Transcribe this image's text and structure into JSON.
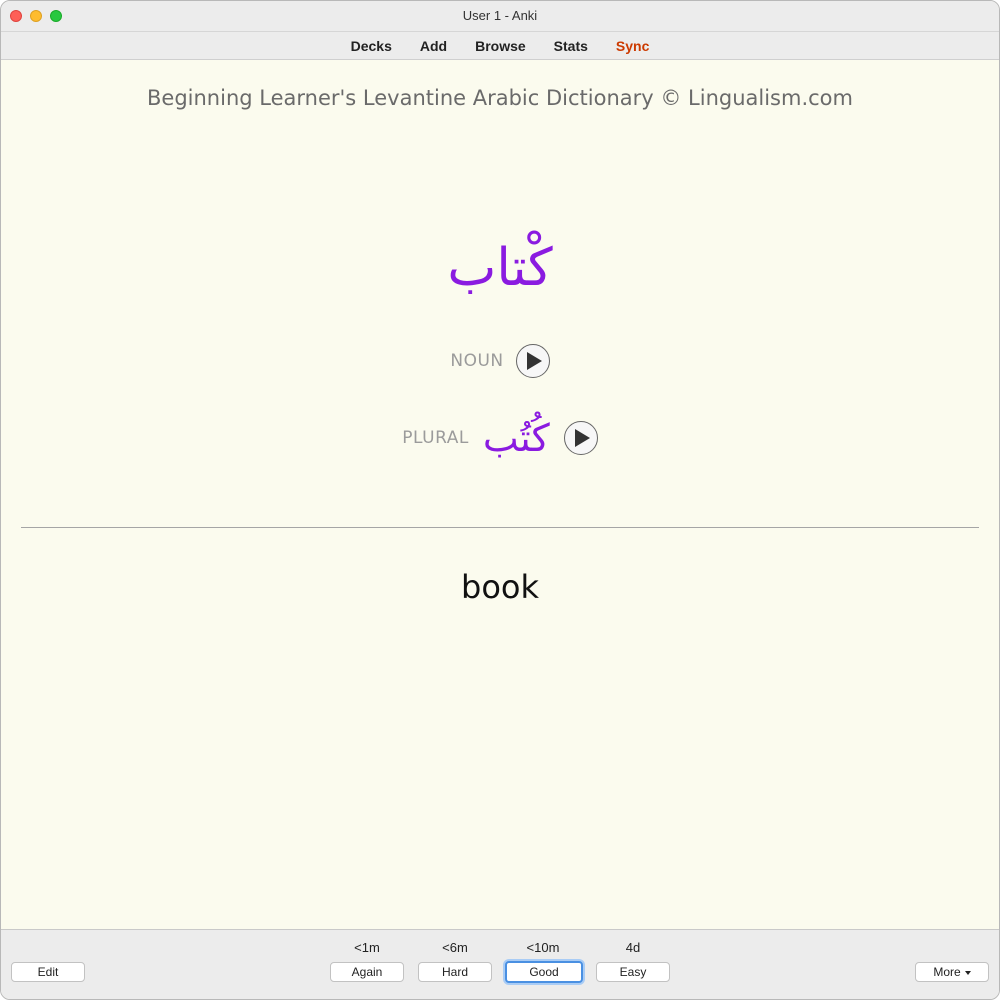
{
  "window": {
    "title": "User 1 - Anki"
  },
  "menu": {
    "decks": "Decks",
    "add": "Add",
    "browse": "Browse",
    "stats": "Stats",
    "sync": "Sync"
  },
  "card": {
    "deck_title": "Beginning Learner's Levantine Arabic Dictionary © Lingualism.com",
    "word": "كْتاب",
    "pos_label": "NOUN",
    "plural_label": "PLURAL",
    "plural_word": "كُتُب",
    "answer": "book"
  },
  "answer_bar": {
    "edit_label": "Edit",
    "more_label": "More",
    "buttons": [
      {
        "interval": "<1m",
        "label": "Again"
      },
      {
        "interval": "<6m",
        "label": "Hard"
      },
      {
        "interval": "<10m",
        "label": "Good"
      },
      {
        "interval": "4d",
        "label": "Easy"
      }
    ]
  },
  "colors": {
    "arabic": "#8a1be0",
    "sync": "#cc3a00",
    "card_bg": "#fbfbee",
    "focus": "#4a90e2"
  },
  "icons": {
    "audio_play": "play-icon",
    "more_dropdown": "chevron-down-icon"
  }
}
